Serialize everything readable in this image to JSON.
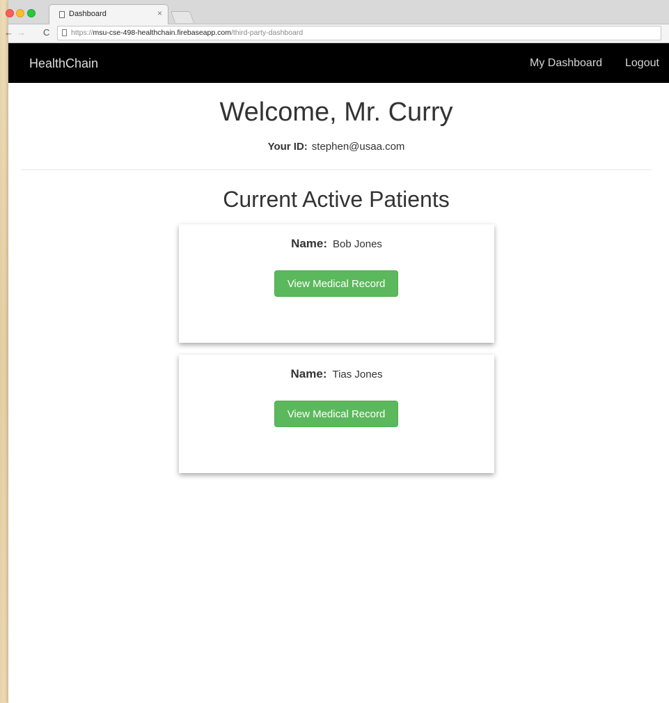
{
  "browser": {
    "tab_title": "Dashboard",
    "tab_close": "×",
    "url_scheme": "https://",
    "url_host": "msu-cse-498-healthchain.firebaseapp.com",
    "url_path": "/third-party-dashboard"
  },
  "navbar": {
    "brand": "HealthChain",
    "links": [
      "My Dashboard",
      "Logout"
    ]
  },
  "header": {
    "welcome": "Welcome, Mr. Curry",
    "id_label": "Your ID:",
    "id_value": "stephen@usaa.com"
  },
  "patients": {
    "title": "Current Active Patients",
    "name_label": "Name:",
    "button_label": "View Medical Record",
    "items": [
      {
        "name": "Bob Jones"
      },
      {
        "name": "Tias Jones"
      }
    ]
  },
  "colors": {
    "navbar_bg": "#000000",
    "button_green": "#5cb85c"
  }
}
